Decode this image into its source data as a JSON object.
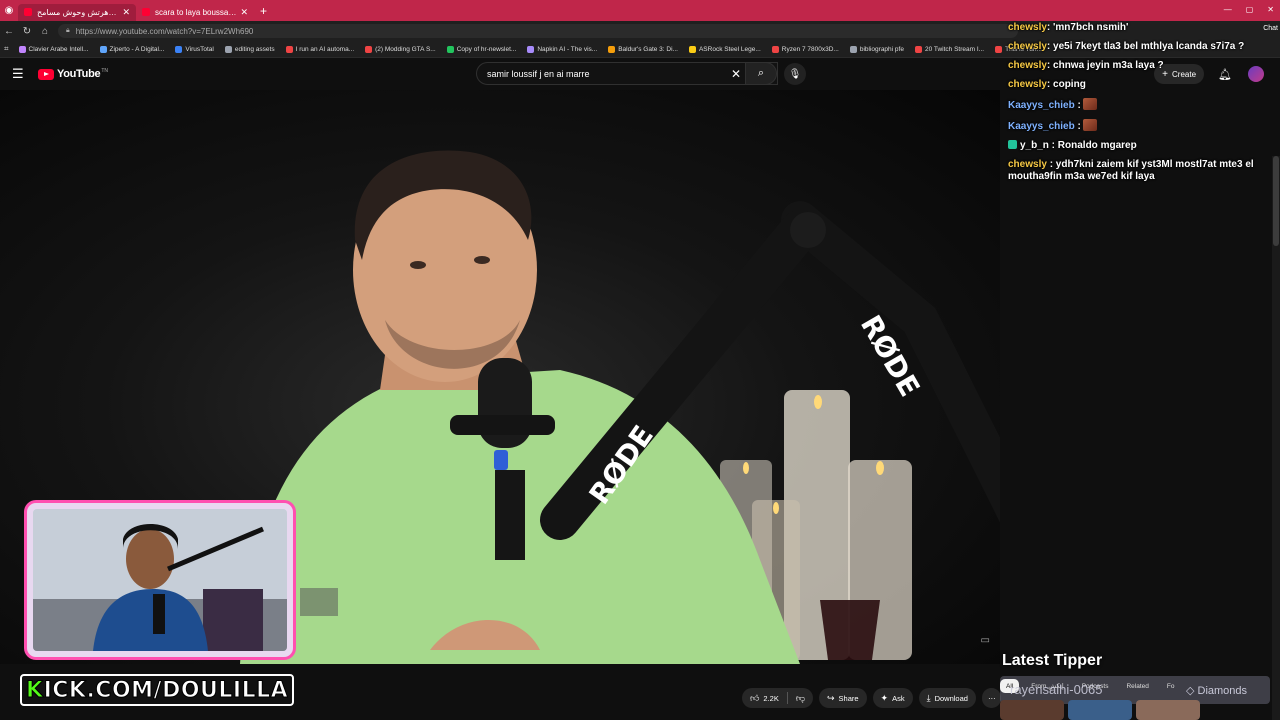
{
  "browser": {
    "tabs": [
      {
        "label": "شرا لايا : ماهرتش وحوش مسامح",
        "active": true
      },
      {
        "label": "scara to laya boussaada - YouTube",
        "active": false
      }
    ],
    "url": "https://www.youtube.com/watch?v=7ELrw2Wh690",
    "bookmarks": [
      {
        "label": "Clavier Arabe Intell...",
        "color": "#c084fc"
      },
      {
        "label": "Ziperto - A Digital...",
        "color": "#60a5fa"
      },
      {
        "label": "VirusTotal",
        "color": "#3b82f6"
      },
      {
        "label": "editing assets",
        "color": "#9ca3af"
      },
      {
        "label": "I run an AI automa...",
        "color": "#ef4444"
      },
      {
        "label": "(2) Modding GTA S...",
        "color": "#ef4444"
      },
      {
        "label": "Copy of hr-newslet...",
        "color": "#22c55e"
      },
      {
        "label": "Napkin AI - The vis...",
        "color": "#a78bfa"
      },
      {
        "label": "Baldur's Gate 3: Di...",
        "color": "#f59e0b"
      },
      {
        "label": "ASRock Steel Lege...",
        "color": "#facc15"
      },
      {
        "label": "Ryzen 7 7800x3D...",
        "color": "#ef4444"
      },
      {
        "label": "bibliographi pfe",
        "color": "#9ca3af"
      },
      {
        "label": "20 Twitch Stream I...",
        "color": "#ef4444"
      },
      {
        "label": "This is Tun...",
        "color": "#ef4444"
      }
    ]
  },
  "youtube": {
    "logo": "YouTube",
    "logo_tm": "TN",
    "search_value": "samir loussif j en ai marre",
    "create_label": "Create",
    "actions": {
      "likes": "2.2K",
      "share": "Share",
      "ask": "Ask",
      "download": "Download"
    },
    "chips": [
      "All",
      "From إنكش",
      "Podcasts",
      "Related",
      "Fo"
    ]
  },
  "stream": {
    "brand": "KICK.COM/DOULILLA",
    "brand_k": "K",
    "brand_rest": "ICK.COM/DOULILLA",
    "latest_tipper_title": "Latest Tipper",
    "latest_tipper_name": "rayensalhi-0065",
    "latest_tipper_amount": "Diamonds",
    "accent_color": "#ff4fb0",
    "kick_green": "#53fc18",
    "chat_tab": "Chat"
  },
  "chat": [
    {
      "user": "chewsly",
      "color": "#f6c945",
      "text": ": 'mn7bch nsmih'"
    },
    {
      "user": "chewsly",
      "color": "#f6c945",
      "text": ": ye5i 7keyt tla3 bel mthlya lcanda s7i7a ?"
    },
    {
      "user": "chewsly",
      "color": "#f6c945",
      "text": ": chnwa jeyin m3a laya ?"
    },
    {
      "user": "chewsly",
      "color": "#f6c945",
      "text": ": coping"
    },
    {
      "user": "Kaayys_chieb",
      "color": "#7fb2ff",
      "text": " :",
      "emote": true
    },
    {
      "user": "Kaayys_chieb",
      "color": "#7fb2ff",
      "text": " :",
      "emote": true
    },
    {
      "user": "y_b_n",
      "color": "#ffffff",
      "text": " : Ronaldo mgarep",
      "badge": true
    },
    {
      "user": "chewsly",
      "color": "#f6c945",
      "text": " : ydh7kni zaiem kif yst3Ml mostl7at mte3 el moutha9fin m3a we7ed kif laya"
    }
  ]
}
